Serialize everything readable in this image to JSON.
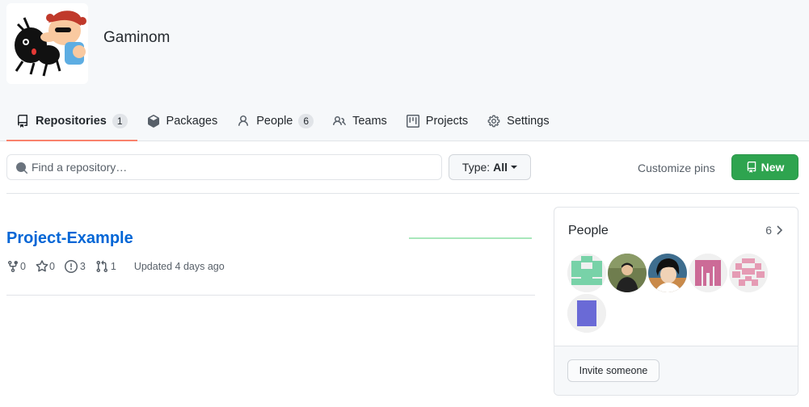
{
  "org": {
    "name": "Gaminom",
    "avatar_icon": "ant-cartoon-avatar"
  },
  "tabs": [
    {
      "label": "Repositories",
      "count": "1",
      "icon": "repo-icon",
      "selected": true
    },
    {
      "label": "Packages",
      "icon": "package-icon"
    },
    {
      "label": "People",
      "count": "6",
      "icon": "person-icon"
    },
    {
      "label": "Teams",
      "icon": "people-icon"
    },
    {
      "label": "Projects",
      "icon": "project-icon"
    },
    {
      "label": "Settings",
      "icon": "gear-icon"
    }
  ],
  "toolbar": {
    "search_placeholder": "Find a repository…",
    "type_label": "Type:",
    "type_value": "All",
    "customize_label": "Customize pins",
    "new_label": "New"
  },
  "repos": [
    {
      "name": "Project-Example",
      "forks": "0",
      "stars": "0",
      "issues": "3",
      "pulls": "1",
      "updated": "Updated 4 days ago"
    }
  ],
  "people": {
    "title": "People",
    "count": "6",
    "invite_label": "Invite someone"
  },
  "colors": {
    "accent_underline": "#f9826c",
    "link": "#0366d6",
    "primary_button": "#2ea44f"
  }
}
